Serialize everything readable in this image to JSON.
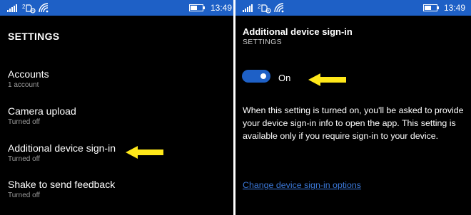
{
  "colors": {
    "accent": "#1e60c6",
    "link": "#3b78d8",
    "annotation_arrow": "#ffe81a",
    "subtext": "#9a9a9a"
  },
  "left_screen": {
    "status_time": "13:49",
    "title": "SETTINGS",
    "items": [
      {
        "title": "Accounts",
        "subtitle": "1 account"
      },
      {
        "title": "Camera upload",
        "subtitle": "Turned off"
      },
      {
        "title": "Additional device sign-in",
        "subtitle": "Turned off"
      },
      {
        "title": "Shake to send feedback",
        "subtitle": "Turned off"
      }
    ]
  },
  "right_screen": {
    "status_time": "13:49",
    "title": "Additional device sign-in",
    "subtitle": "SETTINGS",
    "toggle": {
      "state": "on",
      "label": "On"
    },
    "description": "When this setting is turned on, you'll be asked to provide your device sign-in info to open the app. This setting is available only if you require sign-in to your device.",
    "link": "Change device sign-in options"
  },
  "icons": [
    "signal-icon",
    "sim-icon",
    "wifi-icon",
    "battery-icon",
    "arrow-icon"
  ]
}
